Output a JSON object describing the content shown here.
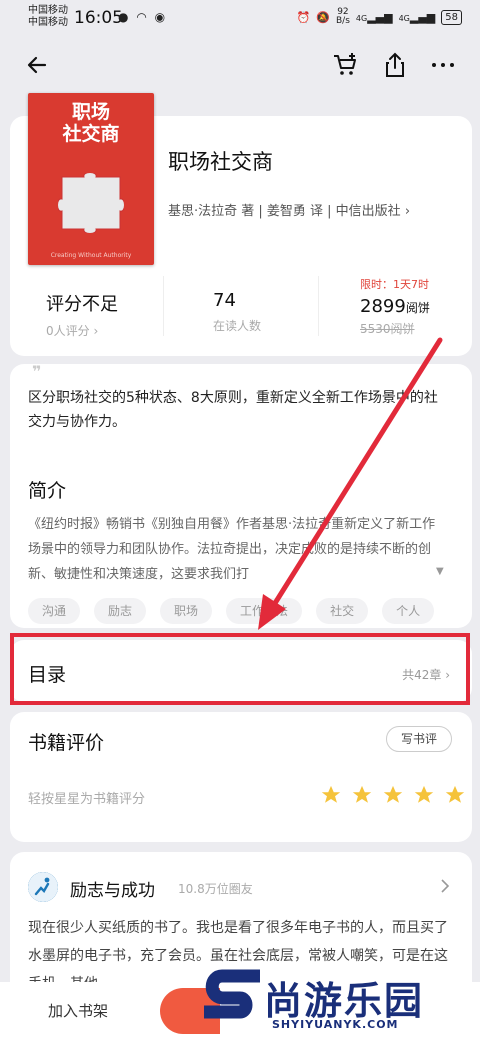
{
  "status": {
    "carrier1": "中国移动",
    "carrier2": "中国移动",
    "time": "16:05",
    "net_speed_value": "92",
    "net_speed_unit": "B/s",
    "signal1": "4G",
    "signal2": "4G",
    "battery": "58"
  },
  "book": {
    "cover_title_line1": "职场",
    "cover_title_line2": "社交商",
    "cover_footer": "Creating Without Authority",
    "title": "职场社交商",
    "author_line": "基思·法拉奇 著 | 姜智勇 译 | 中信出版社"
  },
  "stats": {
    "rating_main": "评分不足",
    "rating_sub": "0人评分",
    "readers_main": "74",
    "readers_sub": "在读人数",
    "limited": "限时：1天7时",
    "price_value": "2899",
    "price_unit": "阅饼",
    "price_old": "5530阅饼"
  },
  "description": {
    "tagline": "区分职场社交的5种状态、8大原则，重新定义全新工作场景中的社交力与协作力。",
    "intro_title": "简介",
    "intro_text": "《纽约时报》畅销书《别独自用餐》作者基思·法拉奇重新定义了新工作场景中的领导力和团队协作。法拉奇提出，决定成败的是持续不断的创新、敏捷性和决策速度，这要求我们打",
    "tags": [
      "沟通",
      "励志",
      "职场",
      "工作方法",
      "社交",
      "个人"
    ]
  },
  "toc": {
    "title": "目录",
    "count": "共42章"
  },
  "review": {
    "title": "书籍评价",
    "write_label": "写书评",
    "hint": "轻按星星为书籍评分",
    "star_color": "#f5c33b"
  },
  "post": {
    "circle_name": "励志与成功",
    "members": "10.8万位圈友",
    "body": "现在很少人买纸质的书了。我也是看了很多年电子书的人，而且买了水墨屏的电子书，充了会员。虽在社会底层，常被人嘲笑，可是在这手机、其他"
  },
  "bottom": {
    "add_shelf": "加入书架"
  },
  "watermark": {
    "brand": "尚游乐园",
    "url": "SHYIYUANYK.COM",
    "color": "#1a2f7a"
  },
  "colors": {
    "accent": "#e0443a",
    "highlight": "#e22a3a",
    "read_button": "#f05a40"
  }
}
